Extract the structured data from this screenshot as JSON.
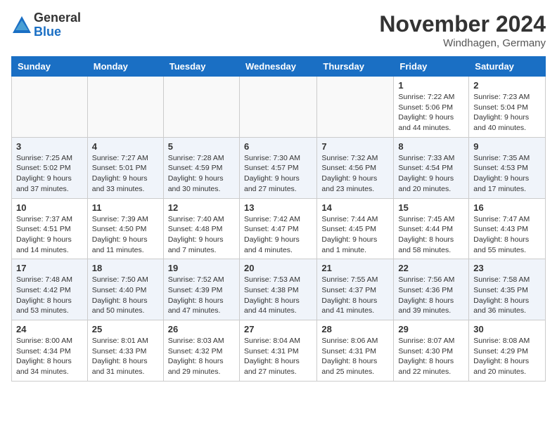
{
  "logo": {
    "general": "General",
    "blue": "Blue"
  },
  "title": "November 2024",
  "location": "Windhagen, Germany",
  "days_of_week": [
    "Sunday",
    "Monday",
    "Tuesday",
    "Wednesday",
    "Thursday",
    "Friday",
    "Saturday"
  ],
  "weeks": [
    [
      {
        "day": "",
        "sunrise": "",
        "sunset": "",
        "daylight": ""
      },
      {
        "day": "",
        "sunrise": "",
        "sunset": "",
        "daylight": ""
      },
      {
        "day": "",
        "sunrise": "",
        "sunset": "",
        "daylight": ""
      },
      {
        "day": "",
        "sunrise": "",
        "sunset": "",
        "daylight": ""
      },
      {
        "day": "",
        "sunrise": "",
        "sunset": "",
        "daylight": ""
      },
      {
        "day": "1",
        "sunrise": "Sunrise: 7:22 AM",
        "sunset": "Sunset: 5:06 PM",
        "daylight": "Daylight: 9 hours and 44 minutes."
      },
      {
        "day": "2",
        "sunrise": "Sunrise: 7:23 AM",
        "sunset": "Sunset: 5:04 PM",
        "daylight": "Daylight: 9 hours and 40 minutes."
      }
    ],
    [
      {
        "day": "3",
        "sunrise": "Sunrise: 7:25 AM",
        "sunset": "Sunset: 5:02 PM",
        "daylight": "Daylight: 9 hours and 37 minutes."
      },
      {
        "day": "4",
        "sunrise": "Sunrise: 7:27 AM",
        "sunset": "Sunset: 5:01 PM",
        "daylight": "Daylight: 9 hours and 33 minutes."
      },
      {
        "day": "5",
        "sunrise": "Sunrise: 7:28 AM",
        "sunset": "Sunset: 4:59 PM",
        "daylight": "Daylight: 9 hours and 30 minutes."
      },
      {
        "day": "6",
        "sunrise": "Sunrise: 7:30 AM",
        "sunset": "Sunset: 4:57 PM",
        "daylight": "Daylight: 9 hours and 27 minutes."
      },
      {
        "day": "7",
        "sunrise": "Sunrise: 7:32 AM",
        "sunset": "Sunset: 4:56 PM",
        "daylight": "Daylight: 9 hours and 23 minutes."
      },
      {
        "day": "8",
        "sunrise": "Sunrise: 7:33 AM",
        "sunset": "Sunset: 4:54 PM",
        "daylight": "Daylight: 9 hours and 20 minutes."
      },
      {
        "day": "9",
        "sunrise": "Sunrise: 7:35 AM",
        "sunset": "Sunset: 4:53 PM",
        "daylight": "Daylight: 9 hours and 17 minutes."
      }
    ],
    [
      {
        "day": "10",
        "sunrise": "Sunrise: 7:37 AM",
        "sunset": "Sunset: 4:51 PM",
        "daylight": "Daylight: 9 hours and 14 minutes."
      },
      {
        "day": "11",
        "sunrise": "Sunrise: 7:39 AM",
        "sunset": "Sunset: 4:50 PM",
        "daylight": "Daylight: 9 hours and 11 minutes."
      },
      {
        "day": "12",
        "sunrise": "Sunrise: 7:40 AM",
        "sunset": "Sunset: 4:48 PM",
        "daylight": "Daylight: 9 hours and 7 minutes."
      },
      {
        "day": "13",
        "sunrise": "Sunrise: 7:42 AM",
        "sunset": "Sunset: 4:47 PM",
        "daylight": "Daylight: 9 hours and 4 minutes."
      },
      {
        "day": "14",
        "sunrise": "Sunrise: 7:44 AM",
        "sunset": "Sunset: 4:45 PM",
        "daylight": "Daylight: 9 hours and 1 minute."
      },
      {
        "day": "15",
        "sunrise": "Sunrise: 7:45 AM",
        "sunset": "Sunset: 4:44 PM",
        "daylight": "Daylight: 8 hours and 58 minutes."
      },
      {
        "day": "16",
        "sunrise": "Sunrise: 7:47 AM",
        "sunset": "Sunset: 4:43 PM",
        "daylight": "Daylight: 8 hours and 55 minutes."
      }
    ],
    [
      {
        "day": "17",
        "sunrise": "Sunrise: 7:48 AM",
        "sunset": "Sunset: 4:42 PM",
        "daylight": "Daylight: 8 hours and 53 minutes."
      },
      {
        "day": "18",
        "sunrise": "Sunrise: 7:50 AM",
        "sunset": "Sunset: 4:40 PM",
        "daylight": "Daylight: 8 hours and 50 minutes."
      },
      {
        "day": "19",
        "sunrise": "Sunrise: 7:52 AM",
        "sunset": "Sunset: 4:39 PM",
        "daylight": "Daylight: 8 hours and 47 minutes."
      },
      {
        "day": "20",
        "sunrise": "Sunrise: 7:53 AM",
        "sunset": "Sunset: 4:38 PM",
        "daylight": "Daylight: 8 hours and 44 minutes."
      },
      {
        "day": "21",
        "sunrise": "Sunrise: 7:55 AM",
        "sunset": "Sunset: 4:37 PM",
        "daylight": "Daylight: 8 hours and 41 minutes."
      },
      {
        "day": "22",
        "sunrise": "Sunrise: 7:56 AM",
        "sunset": "Sunset: 4:36 PM",
        "daylight": "Daylight: 8 hours and 39 minutes."
      },
      {
        "day": "23",
        "sunrise": "Sunrise: 7:58 AM",
        "sunset": "Sunset: 4:35 PM",
        "daylight": "Daylight: 8 hours and 36 minutes."
      }
    ],
    [
      {
        "day": "24",
        "sunrise": "Sunrise: 8:00 AM",
        "sunset": "Sunset: 4:34 PM",
        "daylight": "Daylight: 8 hours and 34 minutes."
      },
      {
        "day": "25",
        "sunrise": "Sunrise: 8:01 AM",
        "sunset": "Sunset: 4:33 PM",
        "daylight": "Daylight: 8 hours and 31 minutes."
      },
      {
        "day": "26",
        "sunrise": "Sunrise: 8:03 AM",
        "sunset": "Sunset: 4:32 PM",
        "daylight": "Daylight: 8 hours and 29 minutes."
      },
      {
        "day": "27",
        "sunrise": "Sunrise: 8:04 AM",
        "sunset": "Sunset: 4:31 PM",
        "daylight": "Daylight: 8 hours and 27 minutes."
      },
      {
        "day": "28",
        "sunrise": "Sunrise: 8:06 AM",
        "sunset": "Sunset: 4:31 PM",
        "daylight": "Daylight: 8 hours and 25 minutes."
      },
      {
        "day": "29",
        "sunrise": "Sunrise: 8:07 AM",
        "sunset": "Sunset: 4:30 PM",
        "daylight": "Daylight: 8 hours and 22 minutes."
      },
      {
        "day": "30",
        "sunrise": "Sunrise: 8:08 AM",
        "sunset": "Sunset: 4:29 PM",
        "daylight": "Daylight: 8 hours and 20 minutes."
      }
    ]
  ]
}
